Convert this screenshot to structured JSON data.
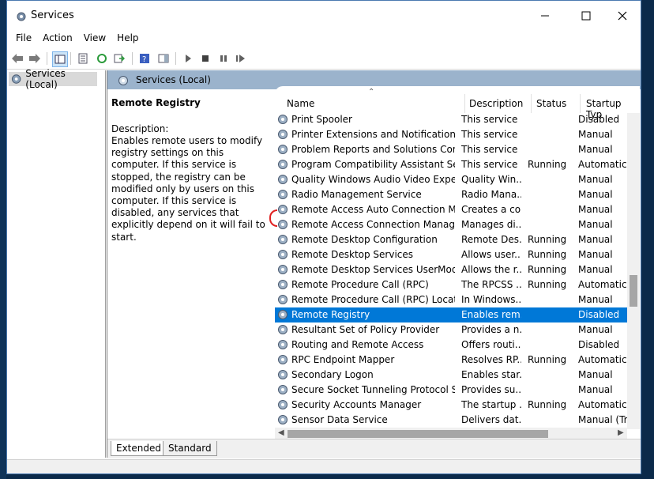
{
  "window": {
    "title": "Services"
  },
  "menu": [
    "File",
    "Action",
    "View",
    "Help"
  ],
  "tree": {
    "root_label": "Services (Local)"
  },
  "content_header": {
    "label": "Services (Local)"
  },
  "description_pane": {
    "service_name": "Remote Registry",
    "label": "Description:",
    "text": "Enables remote users to modify registry settings on this computer. If this service is stopped, the registry can be modified only by users on this computer. If this service is disabled, any services that explicitly depend on it will fail to start."
  },
  "columns": {
    "name": "Name",
    "description": "Description",
    "status": "Status",
    "startup": "Startup Typ"
  },
  "services": [
    {
      "name": "Print Spooler",
      "description": "This service ...",
      "status": "",
      "startup": "Disabled"
    },
    {
      "name": "Printer Extensions and Notifications",
      "description": "This service ...",
      "status": "",
      "startup": "Manual"
    },
    {
      "name": "Problem Reports and Solutions Contr...",
      "description": "This service ...",
      "status": "",
      "startup": "Manual"
    },
    {
      "name": "Program Compatibility Assistant Serv...",
      "description": "This service ...",
      "status": "Running",
      "startup": "Automatic"
    },
    {
      "name": "Quality Windows Audio Video Experie...",
      "description": "Quality Win...",
      "status": "",
      "startup": "Manual"
    },
    {
      "name": "Radio Management Service",
      "description": "Radio Mana...",
      "status": "",
      "startup": "Manual"
    },
    {
      "name": "Remote Access Auto Connection Ma...",
      "description": "Creates a co...",
      "status": "",
      "startup": "Manual"
    },
    {
      "name": "Remote Access Connection Manager",
      "description": "Manages di...",
      "status": "",
      "startup": "Manual"
    },
    {
      "name": "Remote Desktop Configuration",
      "description": "Remote Des...",
      "status": "Running",
      "startup": "Manual"
    },
    {
      "name": "Remote Desktop Services",
      "description": "Allows user...",
      "status": "Running",
      "startup": "Manual"
    },
    {
      "name": "Remote Desktop Services UserMode ...",
      "description": "Allows the r...",
      "status": "Running",
      "startup": "Manual"
    },
    {
      "name": "Remote Procedure Call (RPC)",
      "description": "The RPCSS ...",
      "status": "Running",
      "startup": "Automatic"
    },
    {
      "name": "Remote Procedure Call (RPC) Locator",
      "description": "In Windows...",
      "status": "",
      "startup": "Manual"
    },
    {
      "name": "Remote Registry",
      "description": "Enables rem...",
      "status": "",
      "startup": "Disabled",
      "selected": true
    },
    {
      "name": "Resultant Set of Policy Provider",
      "description": "Provides a n...",
      "status": "",
      "startup": "Manual"
    },
    {
      "name": "Routing and Remote Access",
      "description": "Offers routi...",
      "status": "",
      "startup": "Disabled"
    },
    {
      "name": "RPC Endpoint Mapper",
      "description": "Resolves RP...",
      "status": "Running",
      "startup": "Automatic"
    },
    {
      "name": "Secondary Logon",
      "description": "Enables star...",
      "status": "",
      "startup": "Manual"
    },
    {
      "name": "Secure Socket Tunneling Protocol Ser...",
      "description": "Provides su...",
      "status": "",
      "startup": "Manual"
    },
    {
      "name": "Security Accounts Manager",
      "description": "The startup ...",
      "status": "Running",
      "startup": "Automatic"
    },
    {
      "name": "Sensor Data Service",
      "description": "Delivers dat...",
      "status": "",
      "startup": "Manual (Tri"
    }
  ],
  "tabs": [
    "Extended",
    "Standard"
  ],
  "colors": {
    "selection": "#0078d7",
    "header_band": "#9bb3cc"
  }
}
